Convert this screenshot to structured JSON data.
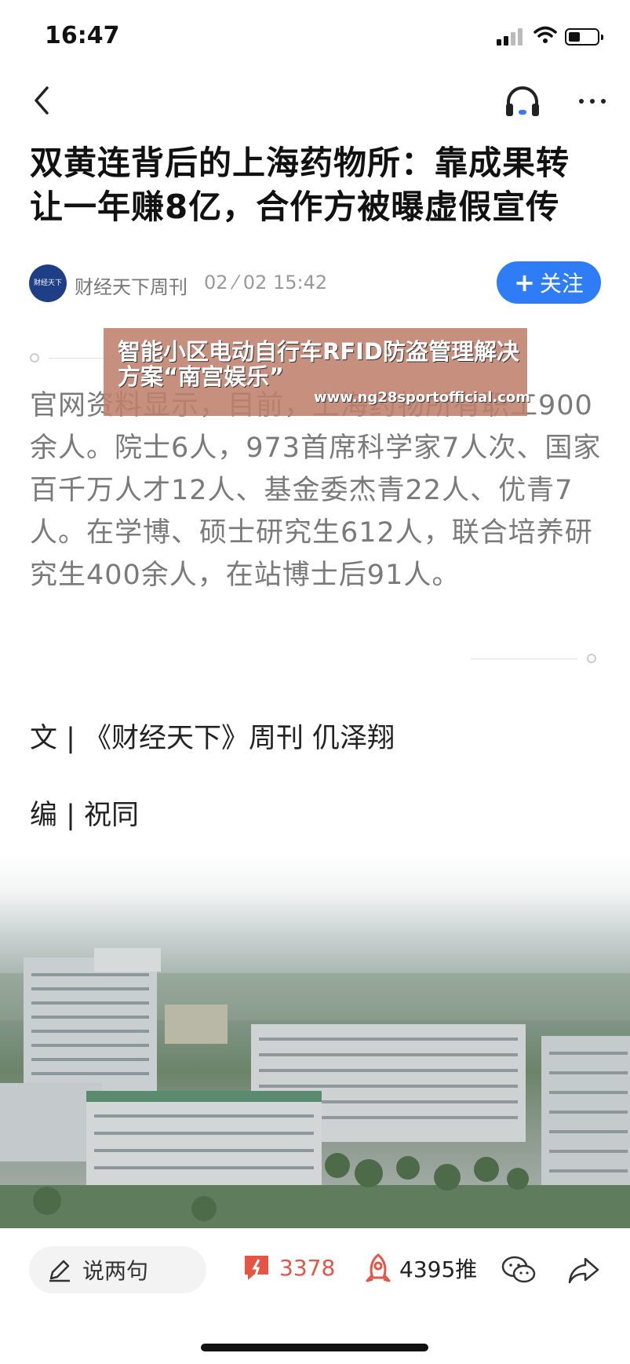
{
  "status_bar": {
    "time": "16:47"
  },
  "article": {
    "title": "双黄连背后的上海药物所：靠成果转让一年赚8亿，合作方被曝虚假宣传",
    "author": "财经天下周刊",
    "author_avatar_text": "财经天下",
    "time": "02 ⁄ 02 15:42",
    "follow_label": "关注",
    "body": "官网资料显示，目前，上海药物所有职工900余人。院士6人，973首席科学家7人次、国家百千万人才12人、基金委杰青22人、优青7人。在学博、硕士研究生612人，联合培养研究生400余人，在站博士后91人。",
    "credit_writer": "文 | 《财经天下》周刊 仉泽翔",
    "credit_editor": "编 | 祝同"
  },
  "overlay_ad": {
    "text": "智能小区电动自行车RFID防盗管理解决方案“南宫娱乐”",
    "url": "www.ng28sportofficial.com"
  },
  "bottom_bar": {
    "comment_placeholder": "说两句",
    "comment_count": "3378",
    "push_count": "4395推"
  }
}
